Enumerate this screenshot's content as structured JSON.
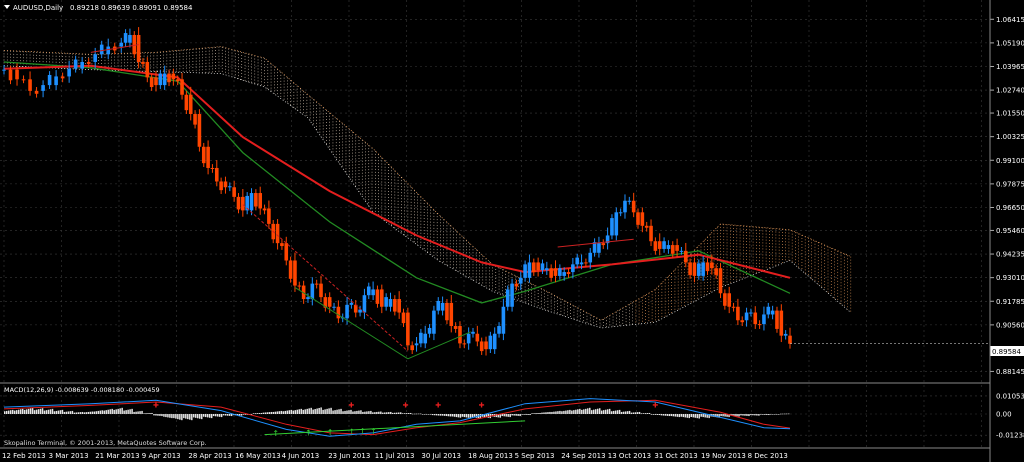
{
  "chart_data": [
    {
      "type": "candlestick",
      "symbol_label": "AUDUSD,Daily",
      "ohlc_label": "0.89218 0.89639 0.89091 0.89584",
      "last_price": 0.89584,
      "last_price_label": "0.89584",
      "ylim": [
        0.877,
        1.07
      ],
      "y_ticks": [
        "1.06415",
        "1.05190",
        "1.03965",
        "1.02740",
        "1.01550",
        "1.00325",
        "0.99100",
        "0.97875",
        "0.96650",
        "0.95460",
        "0.94235",
        "0.93010",
        "0.91785",
        "0.90560",
        "0.88145"
      ],
      "x_ticks": [
        "12 Feb 2013",
        "3 Mar 2013",
        "21 Mar 2013",
        "9 Apr 2013",
        "28 Apr 2013",
        "16 May 2013",
        "4 Jun 2013",
        "23 Jun 2013",
        "11 Jul 2013",
        "30 Jul 2013",
        "18 Aug 2013",
        "5 Sep 2013",
        "24 Sep 2013",
        "13 Oct 2013",
        "31 Oct 2013",
        "19 Nov 2013",
        "8 Dec 2013"
      ],
      "grid": true,
      "bull_color": "#1e90ff",
      "bear_color": "#ff4500",
      "close_path": [
        [
          0,
          1.038
        ],
        [
          6,
          1.033
        ],
        [
          12,
          1.027
        ],
        [
          18,
          1.03
        ],
        [
          24,
          1.0345
        ],
        [
          30,
          1.0385
        ],
        [
          36,
          1.042
        ],
        [
          42,
          1.046
        ],
        [
          48,
          1.05
        ],
        [
          54,
          1.052
        ],
        [
          58,
          1.056
        ],
        [
          62,
          1.042
        ],
        [
          66,
          1.034
        ],
        [
          70,
          1.03
        ],
        [
          74,
          1.036
        ],
        [
          78,
          1.033
        ],
        [
          82,
          1.025
        ],
        [
          86,
          1.015
        ],
        [
          90,
          0.998
        ],
        [
          94,
          0.987
        ],
        [
          98,
          0.98
        ],
        [
          102,
          0.977
        ],
        [
          106,
          0.972
        ],
        [
          110,
          0.965
        ],
        [
          114,
          0.974
        ],
        [
          118,
          0.966
        ],
        [
          122,
          0.958
        ],
        [
          126,
          0.948
        ],
        [
          130,
          0.939
        ],
        [
          134,
          0.926
        ],
        [
          138,
          0.919
        ],
        [
          142,
          0.927
        ],
        [
          146,
          0.92
        ],
        [
          150,
          0.915
        ],
        [
          154,
          0.909
        ],
        [
          158,
          0.916
        ],
        [
          162,
          0.912
        ],
        [
          166,
          0.921
        ],
        [
          170,
          0.924
        ],
        [
          174,
          0.915
        ],
        [
          178,
          0.919
        ],
        [
          182,
          0.912
        ],
        [
          186,
          0.895
        ],
        [
          190,
          0.896
        ],
        [
          194,
          0.901
        ],
        [
          198,
          0.913
        ],
        [
          202,
          0.917
        ],
        [
          206,
          0.905
        ],
        [
          210,
          0.896
        ],
        [
          214,
          0.901
        ],
        [
          218,
          0.897
        ],
        [
          222,
          0.893
        ],
        [
          226,
          0.901
        ],
        [
          230,
          0.915
        ],
        [
          234,
          0.927
        ],
        [
          238,
          0.93
        ],
        [
          242,
          0.938
        ],
        [
          246,
          0.934
        ],
        [
          250,
          0.935
        ],
        [
          254,
          0.931
        ],
        [
          258,
          0.933
        ],
        [
          262,
          0.937
        ],
        [
          266,
          0.938
        ],
        [
          270,
          0.943
        ],
        [
          274,
          0.948
        ],
        [
          278,
          0.952
        ],
        [
          282,
          0.964
        ],
        [
          286,
          0.97
        ],
        [
          290,
          0.964
        ],
        [
          294,
          0.957
        ],
        [
          298,
          0.949
        ],
        [
          302,
          0.945
        ],
        [
          306,
          0.947
        ],
        [
          310,
          0.944
        ],
        [
          314,
          0.938
        ],
        [
          318,
          0.931
        ],
        [
          322,
          0.938
        ],
        [
          326,
          0.935
        ],
        [
          330,
          0.922
        ],
        [
          334,
          0.915
        ],
        [
          338,
          0.908
        ],
        [
          342,
          0.912
        ],
        [
          346,
          0.906
        ],
        [
          350,
          0.911
        ],
        [
          354,
          0.913
        ],
        [
          358,
          0.9
        ],
        [
          362,
          0.8958
        ]
      ],
      "sma_red": [
        [
          0,
          1.0385
        ],
        [
          40,
          1.04
        ],
        [
          80,
          1.034
        ],
        [
          110,
          1.003
        ],
        [
          150,
          0.975
        ],
        [
          190,
          0.952
        ],
        [
          220,
          0.938
        ],
        [
          240,
          0.933
        ],
        [
          280,
          0.937
        ],
        [
          320,
          0.942
        ],
        [
          362,
          0.93
        ]
      ],
      "sma_green": [
        [
          0,
          1.042
        ],
        [
          40,
          1.039
        ],
        [
          80,
          1.032
        ],
        [
          110,
          0.995
        ],
        [
          150,
          0.959
        ],
        [
          190,
          0.93
        ],
        [
          220,
          0.917
        ],
        [
          240,
          0.923
        ],
        [
          280,
          0.937
        ],
        [
          320,
          0.944
        ],
        [
          362,
          0.922
        ]
      ],
      "cloud_upper": [
        [
          0,
          1.048
        ],
        [
          40,
          1.046
        ],
        [
          70,
          1.047
        ],
        [
          100,
          1.05
        ],
        [
          120,
          1.044
        ],
        [
          140,
          1.025
        ],
        [
          170,
          0.997
        ],
        [
          200,
          0.963
        ],
        [
          225,
          0.937
        ],
        [
          250,
          0.923
        ],
        [
          275,
          0.908
        ],
        [
          300,
          0.924
        ],
        [
          330,
          0.958
        ],
        [
          362,
          0.955
        ],
        [
          390,
          0.941
        ]
      ],
      "cloud_lower": [
        [
          0,
          1.04
        ],
        [
          40,
          1.038
        ],
        [
          70,
          1.037
        ],
        [
          100,
          1.036
        ],
        [
          120,
          1.029
        ],
        [
          140,
          1.013
        ],
        [
          170,
          0.964
        ],
        [
          200,
          0.939
        ],
        [
          225,
          0.923
        ],
        [
          250,
          0.913
        ],
        [
          275,
          0.904
        ],
        [
          300,
          0.907
        ],
        [
          330,
          0.925
        ],
        [
          362,
          0.939
        ],
        [
          390,
          0.912
        ]
      ]
    },
    {
      "type": "histogram",
      "label": "MACD(12,26,9) -0.008639 -0.008180 -0.000459",
      "ylim": [
        -0.014,
        0.014
      ],
      "y_ticks": [
        "0.010535",
        "0.00",
        "-0.012381"
      ],
      "macd_line": [
        [
          0,
          0.004
        ],
        [
          40,
          0.006
        ],
        [
          70,
          0.008
        ],
        [
          100,
          0.002
        ],
        [
          130,
          -0.009
        ],
        [
          150,
          -0.013
        ],
        [
          170,
          -0.011
        ],
        [
          190,
          -0.006
        ],
        [
          210,
          -0.004
        ],
        [
          240,
          0.006
        ],
        [
          270,
          0.009
        ],
        [
          300,
          0.007
        ],
        [
          330,
          -0.002
        ],
        [
          350,
          -0.008
        ],
        [
          362,
          -0.0086
        ]
      ],
      "signal_line": [
        [
          0,
          0.003
        ],
        [
          40,
          0.005
        ],
        [
          70,
          0.007
        ],
        [
          100,
          0.004
        ],
        [
          130,
          -0.006
        ],
        [
          150,
          -0.011
        ],
        [
          170,
          -0.012
        ],
        [
          190,
          -0.008
        ],
        [
          210,
          -0.005
        ],
        [
          240,
          0.003
        ],
        [
          270,
          0.007
        ],
        [
          300,
          0.008
        ],
        [
          330,
          0.001
        ],
        [
          350,
          -0.006
        ],
        [
          362,
          -0.0082
        ]
      ],
      "histogram_values": [
        0.002,
        0.0025,
        0.003,
        0.0028,
        0.0025,
        0.002,
        0.0015,
        0.001,
        0.0012,
        0.0018,
        0.0025,
        0.003,
        0.0025,
        0.0015,
        0.0005,
        -0.001,
        -0.002,
        -0.003,
        -0.003,
        -0.0025,
        -0.002,
        -0.0015,
        -0.001,
        -0.0008,
        -0.0005,
        0.0005,
        0.001,
        0.0015,
        0.002,
        0.0025,
        0.003,
        0.0032,
        0.003,
        0.0025,
        0.002,
        0.0018,
        0.0015,
        0.0012,
        0.001,
        0.0008,
        0.0005,
        0.0002,
        -0.0002,
        -0.0008,
        -0.0012,
        -0.0018,
        -0.002,
        -0.0022,
        -0.002,
        -0.0018,
        -0.0015,
        -0.001,
        -0.0005,
        0.0005,
        0.001,
        0.0015,
        0.002,
        0.0025,
        0.003,
        0.0028,
        0.0025,
        0.002,
        0.0015,
        0.001,
        0.0005,
        -0.0005,
        -0.001,
        -0.0015,
        -0.002,
        -0.0022,
        -0.002,
        -0.0018,
        -0.0015,
        -0.0012,
        -0.001,
        -0.0008,
        -0.0005,
        -0.0003,
        0.0002
      ],
      "copyright": "Skopalino Terminal, © 2001-2013, MetaQuotes Software Corp."
    }
  ]
}
